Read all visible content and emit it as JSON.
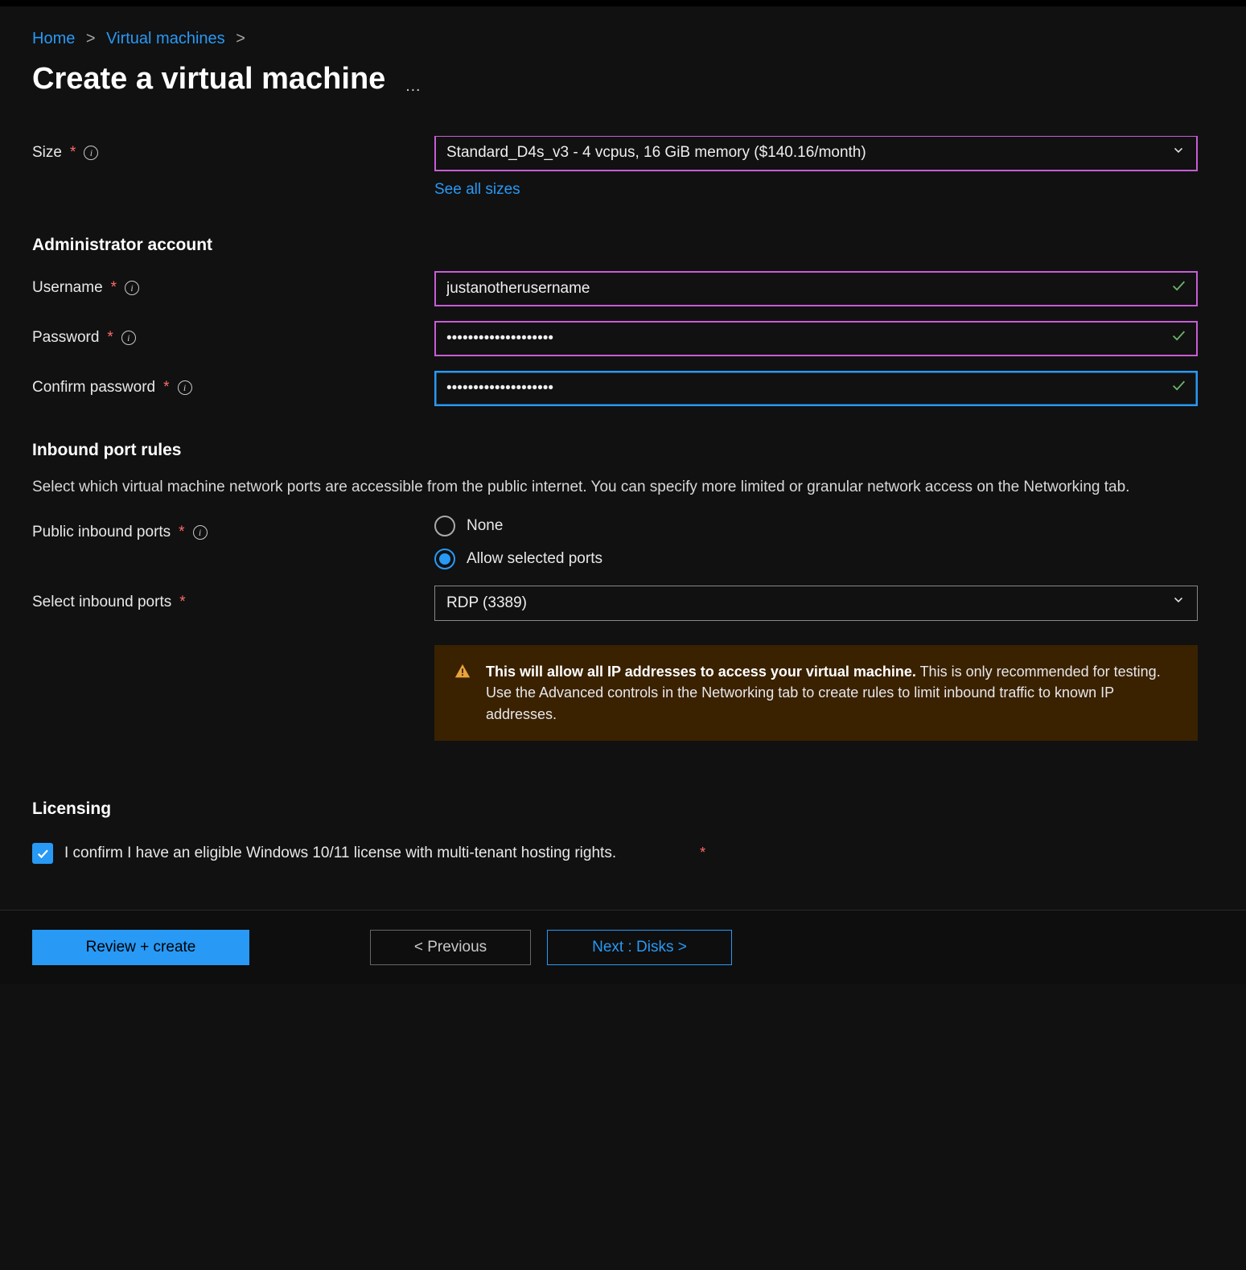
{
  "breadcrumb": {
    "home": "Home",
    "vms": "Virtual machines",
    "sep": ">"
  },
  "page_title": "Create a virtual machine",
  "size": {
    "label": "Size",
    "value": "Standard_D4s_v3 - 4 vcpus, 16 GiB memory ($140.16/month)",
    "see_all": "See all sizes"
  },
  "admin": {
    "heading": "Administrator account",
    "username_label": "Username",
    "username_value": "justanotherusername",
    "password_label": "Password",
    "password_value": "••••••••••••••••••••",
    "confirm_label": "Confirm password",
    "confirm_value": "••••••••••••••••••••"
  },
  "ports": {
    "heading": "Inbound port rules",
    "desc": "Select which virtual machine network ports are accessible from the public internet. You can specify more limited or granular network access on the Networking tab.",
    "public_label": "Public inbound ports",
    "radio_none": "None",
    "radio_allow": "Allow selected ports",
    "select_label": "Select inbound ports",
    "select_value": "RDP (3389)",
    "warning_bold": "This will allow all IP addresses to access your virtual machine.",
    "warning_rest": "  This is only recommended for testing.  Use the Advanced controls in the Networking tab to create rules to limit inbound traffic to known IP addresses."
  },
  "licensing": {
    "heading": "Licensing",
    "confirm_text": "I confirm I have an eligible Windows 10/11 license with multi-tenant hosting rights."
  },
  "footer": {
    "review": "Review + create",
    "prev": "< Previous",
    "next": "Next : Disks >"
  }
}
